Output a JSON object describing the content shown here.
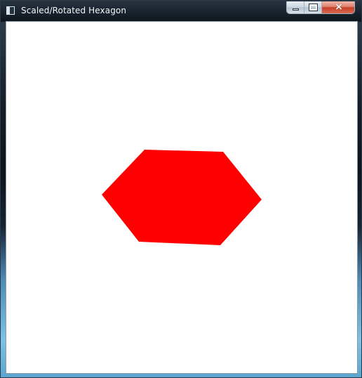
{
  "window": {
    "title": "Scaled/Rotated Hexagon",
    "controls": {
      "minimize": "minimize",
      "maximize": "maximize",
      "close": "close"
    }
  },
  "canvas": {
    "background": "#ffffff",
    "shape": {
      "name": "hexagon",
      "fill": "#ff0000"
    }
  }
}
